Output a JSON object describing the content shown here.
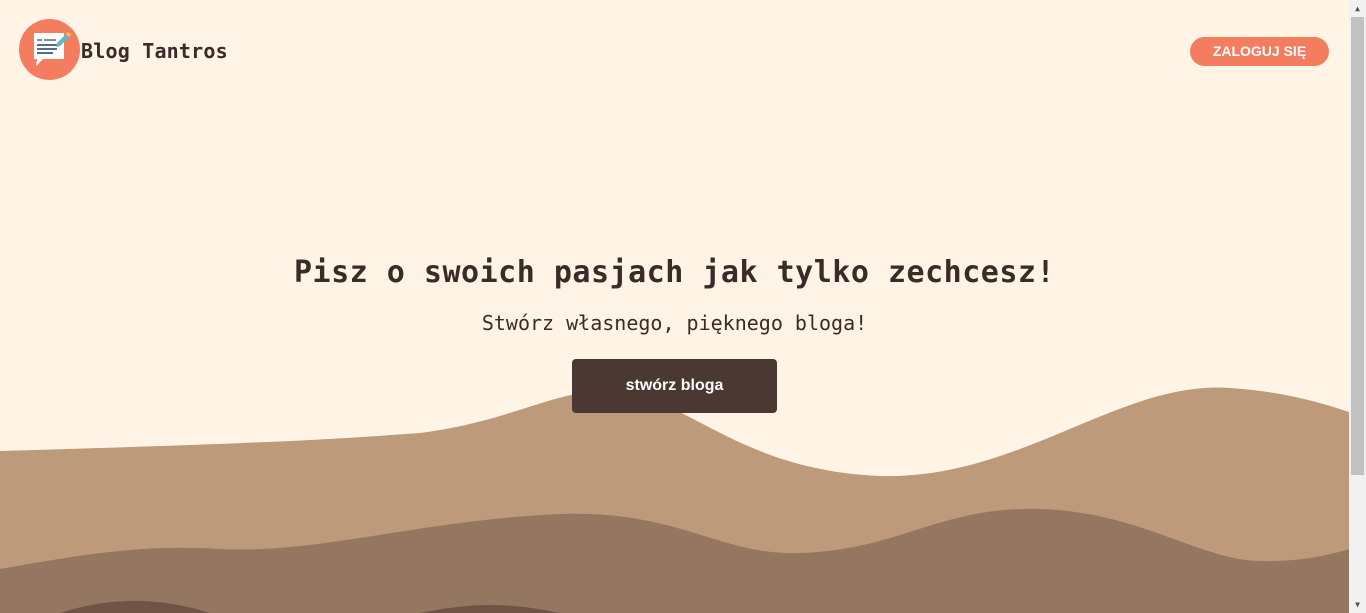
{
  "header": {
    "logo_icon": "blog-post-icon",
    "brand_name": "Blog Tantros",
    "login_label": "ZALOGUJ SIĘ"
  },
  "hero": {
    "title": "Pisz o swoich pasjach jak tylko zechcesz!",
    "subtitle": "Stwórz własnego, pięknego bloga!",
    "cta_label": "stwórz bloga"
  },
  "scrollbar": {
    "up_icon": "▲",
    "down_icon": "▼"
  },
  "colors": {
    "background": "#fff4e6",
    "accent": "#f47c5f",
    "text": "#3b2a27",
    "cta_bg": "#4b3832",
    "wave_light": "#bd9a7a",
    "wave_mid": "#957761",
    "wave_dark": "#6f5446"
  }
}
